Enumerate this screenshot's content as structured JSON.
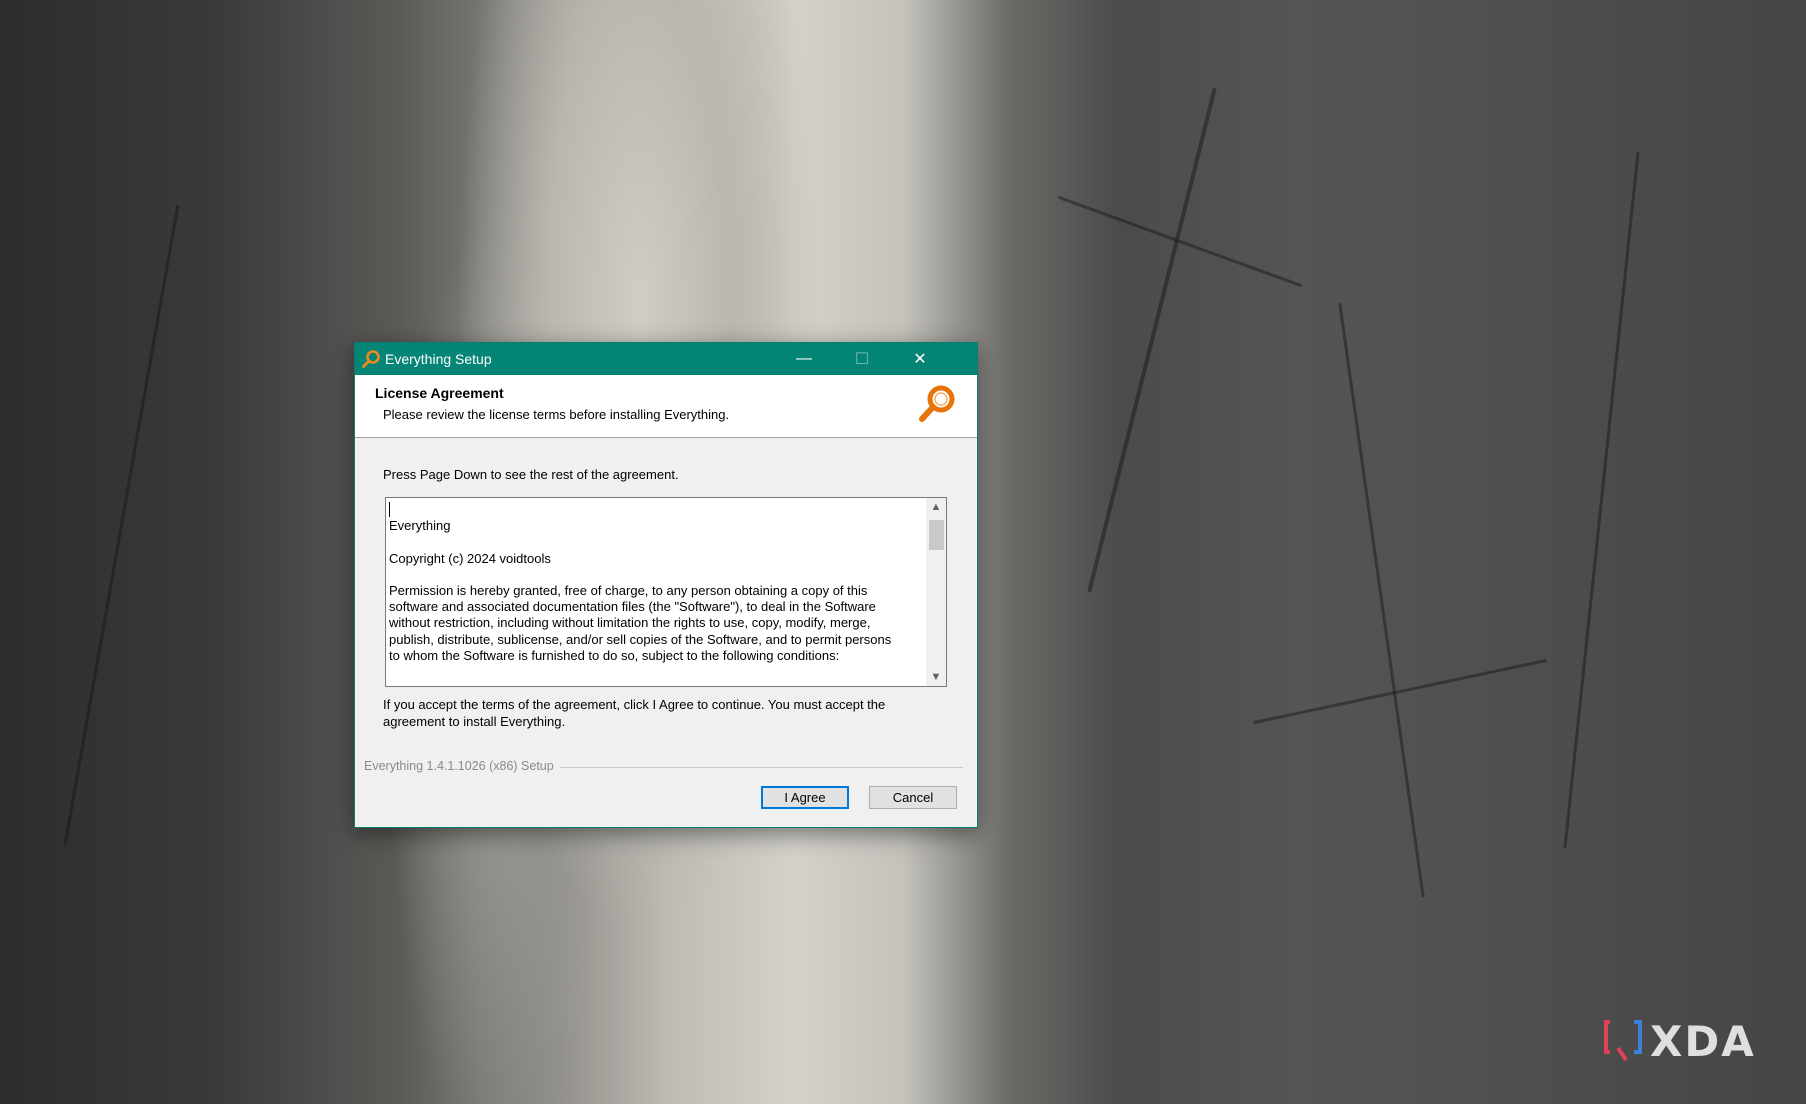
{
  "window": {
    "title": "Everything Setup",
    "controls": {
      "minimize": "—",
      "maximize": "☐",
      "close": "✕"
    }
  },
  "header": {
    "title": "License Agreement",
    "subtitle": "Please review the license terms before installing Everything."
  },
  "body": {
    "intro": "Press Page Down to see the rest of the agreement.",
    "license_lines": [
      "Everything",
      "",
      "Copyright (c) 2024 voidtools",
      "",
      "Permission is hereby granted, free of charge, to any person obtaining a copy of this",
      "software and associated documentation files (the \"Software\"), to deal in the Software",
      "without restriction, including without limitation the rights to use, copy, modify, merge,",
      "publish, distribute, sublicense, and/or sell copies of the Software, and to permit persons",
      "to whom the Software is furnished to do so, subject to the following conditions:"
    ],
    "accept_text": "If you accept the terms of the agreement, click I Agree to continue. You must accept the agreement to install Everything."
  },
  "footer": {
    "brand": "Everything 1.4.1.1026 (x86) Setup",
    "agree_label": "I Agree",
    "cancel_label": "Cancel"
  },
  "watermark": {
    "text": "XDA"
  },
  "colors": {
    "titlebar": "#058575",
    "accent_button_border": "#0078d7",
    "icon_orange": "#e8730c"
  }
}
